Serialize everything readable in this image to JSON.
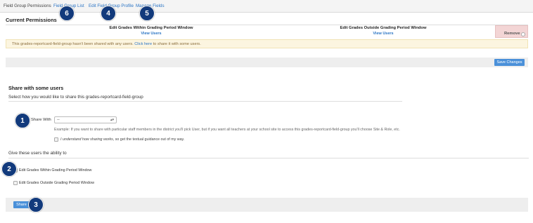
{
  "tabs": {
    "field_group_permissions": "Field Group Permissions",
    "field_group_list": "Field Group List",
    "edit_field_group_profile": "Edit Field Group Profile",
    "manage_fields": "Manage Fields"
  },
  "current_permissions": {
    "title": "Current Permissions",
    "col1_title": "Edit Grades Within Grading Period Window",
    "col1_link": "View Users",
    "col2_title": "Edit Grades Outside Grading Period Window",
    "col2_link": "View Users",
    "remove_label": "Remove"
  },
  "notice": {
    "text_before": "This grades-reportcard-field-group hasn't been shared with any users.",
    "link": "Click here",
    "text_after": "to share it with some users."
  },
  "save_button": "Save Changes",
  "share_section": {
    "title": "Share with some users",
    "subtitle": "Select how you would like to share this grades-reportcard-field-group",
    "share_with_label": "Share With",
    "share_with_value": "--",
    "example": "Example: If you want to share with particular staff members in the district you'll pick User, but if you want all teachers at your school site to access this grades-reportcard-field-group you'll choose Site & Role, etc.",
    "understand_italic": "I understand how sharing works",
    "understand_rest": ", so get the textual guidance out of my way."
  },
  "ability_section": {
    "title": "Give these users the ability to",
    "option1": "Edit Grades Within Grading Period Window",
    "option2": "Edit Grades Outside Grading Period Window"
  },
  "share_button": "Share",
  "badges": {
    "b1": "1",
    "b2": "2",
    "b3": "3",
    "b4": "4",
    "b5": "5",
    "b6": "6"
  },
  "colors": {
    "badge": "#123a7c",
    "link": "#2a74c4",
    "button": "#4a90d9",
    "notice_bg": "#fcf5e0",
    "remove_bg": "#f3d5d5"
  }
}
